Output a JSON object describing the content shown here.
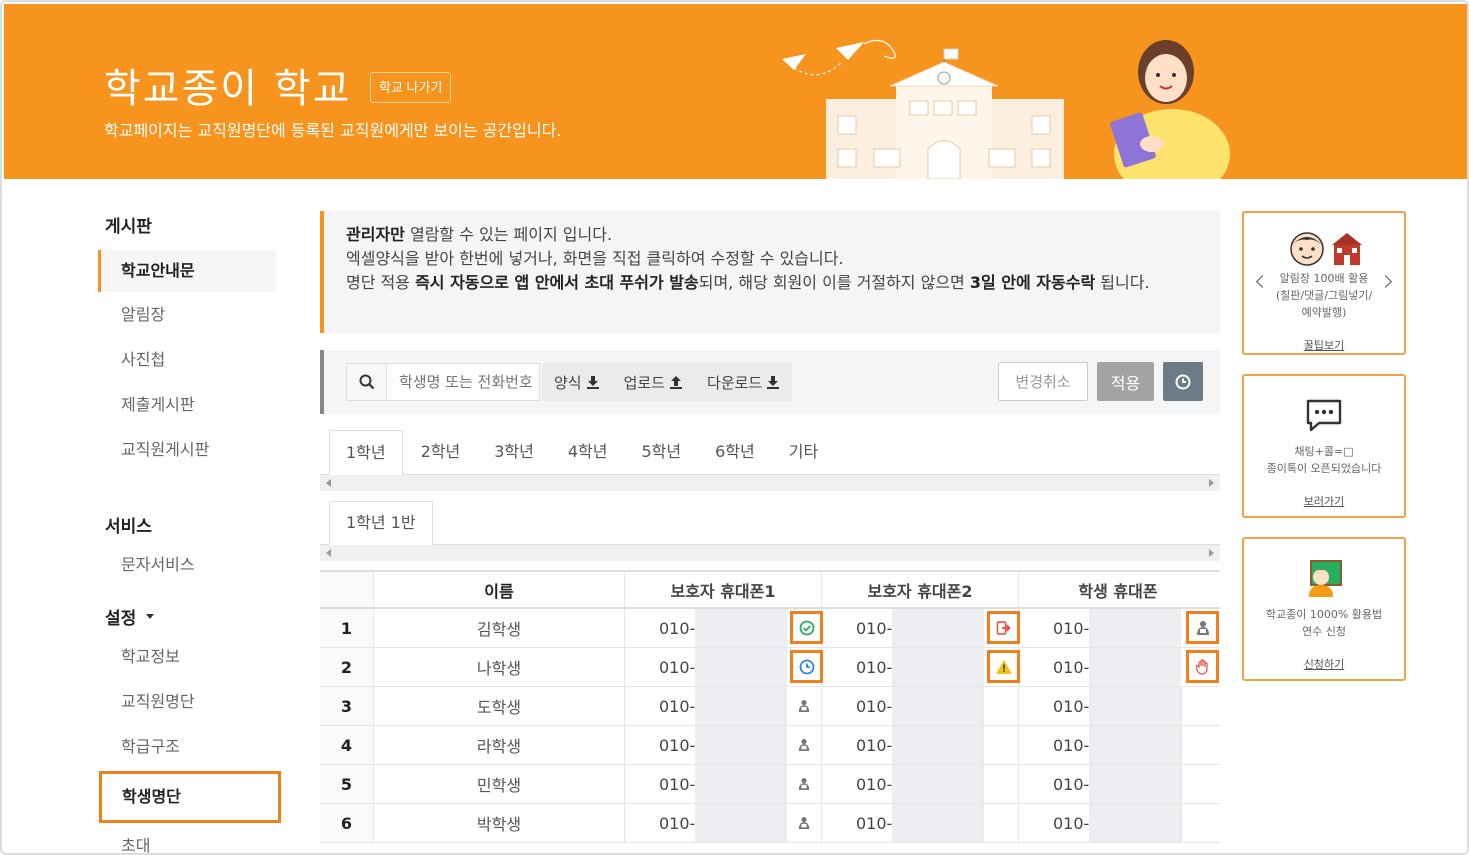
{
  "header": {
    "school_name": "학교종이 학교",
    "leave_button": "학교 나가기",
    "subtitle": "학교페이지는 교직원명단에 등록된 교직원에게만 보이는 공간입니다.",
    "bg_color": "#f7941d"
  },
  "sidebar": {
    "sections": [
      {
        "title": "게시판",
        "items": [
          "학교안내문",
          "알림장",
          "사진첩",
          "제출게시판",
          "교직원게시판"
        ]
      },
      {
        "title": "서비스",
        "items": [
          "문자서비스"
        ]
      },
      {
        "title": "설정",
        "items": [
          "학교정보",
          "교직원명단",
          "학급구조",
          "학생명단",
          "초대"
        ]
      }
    ],
    "active_item": "학교안내문",
    "highlighted_item": "학생명단"
  },
  "notice": {
    "line1_bold": "관리자만",
    "line1_rest": " 열람할 수 있는 페이지 입니다.",
    "line2": "엑셀양식을 받아 한번에 넣거나, 화면을 직접 클릭하여 수정할 수 있습니다.",
    "line3_a": "명단 적용 ",
    "line3_b": "즉시 자동으로 앱 안에서 초대 푸쉬가 발송",
    "line3_c": "되며, 해당 회원이 이를 거절하지 않으면 ",
    "line3_d": "3일 안에 자동수락",
    "line3_e": " 됩니다."
  },
  "toolbar": {
    "search_placeholder": "학생명 또는 전화번호",
    "template_label": "양식",
    "upload_label": "업로드",
    "download_label": "다운로드",
    "cancel_label": "변경취소",
    "apply_label": "적용"
  },
  "grade_tabs": [
    "1학년",
    "2학년",
    "3학년",
    "4학년",
    "5학년",
    "6학년",
    "기타"
  ],
  "class_tab": "1학년 1반",
  "table": {
    "headers": [
      "",
      "이름",
      "보호자 휴대폰1",
      "보호자 휴대폰2",
      "학생 휴대폰"
    ],
    "rows": [
      {
        "no": "1",
        "name": "김학생",
        "p1": "010-",
        "p2": "010-",
        "p3": "010-"
      },
      {
        "no": "2",
        "name": "나학생",
        "p1": "010-",
        "p2": "010-",
        "p3": "010-"
      },
      {
        "no": "3",
        "name": "도학생",
        "p1": "010-",
        "p2": "010-",
        "p3": "010-"
      },
      {
        "no": "4",
        "name": "라학생",
        "p1": "010-",
        "p2": "010-",
        "p3": "010-"
      },
      {
        "no": "5",
        "name": "민학생",
        "p1": "010-",
        "p2": "010-",
        "p3": "010-"
      },
      {
        "no": "6",
        "name": "박학생",
        "p1": "010-",
        "p2": "010-",
        "p3": "010-"
      }
    ]
  },
  "cards": [
    {
      "line1": "알림장 100배 활용",
      "line2": "(칠판/댓글/그림넣기/",
      "line3": "예약발행)",
      "link": "꿀팁보기"
    },
    {
      "line1": "채팅+콜=□",
      "line2": "종이톡이 오픈되었습니다",
      "link": "보러가기"
    },
    {
      "line1": "학교종이 1000% 활용법",
      "line2": "연수 신청",
      "link": "신청하기"
    }
  ]
}
